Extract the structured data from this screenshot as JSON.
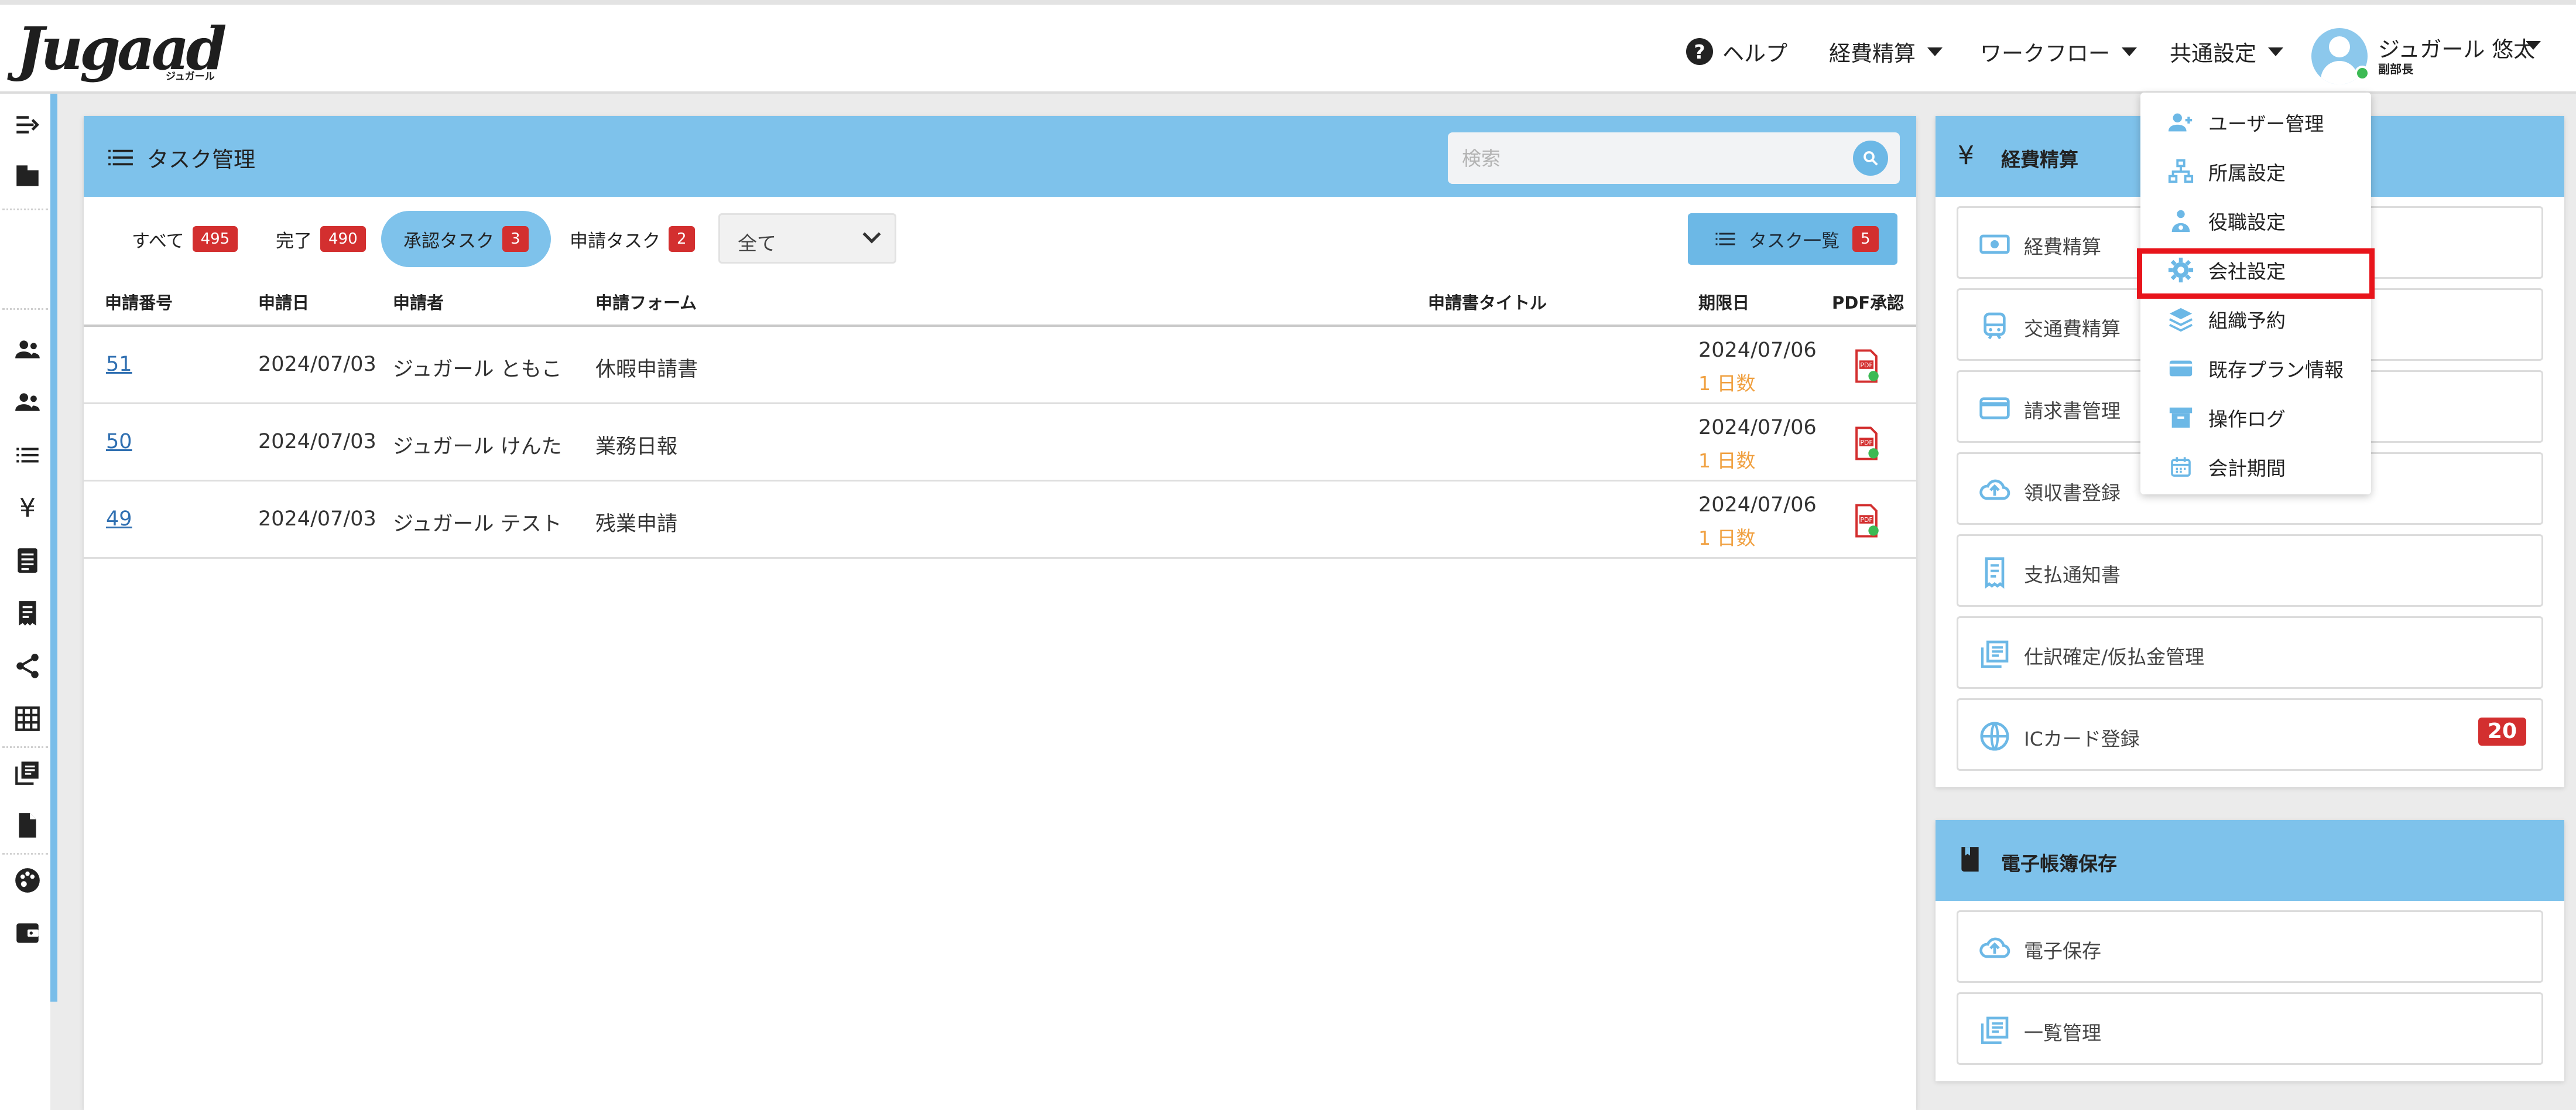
{
  "header": {
    "logo_text": "Jugaad",
    "logo_sub": "ジュガール",
    "nav": {
      "help": "ヘルプ",
      "expense": "経費精算",
      "workflow": "ワークフロー",
      "common": "共通設定"
    },
    "user": {
      "name": "ジュガール 悠太",
      "role": "副部長"
    }
  },
  "task_panel": {
    "title": "タスク管理",
    "search_placeholder": "検索",
    "filters": [
      {
        "label": "すべて",
        "count": "495"
      },
      {
        "label": "完了",
        "count": "490"
      },
      {
        "label": "承認タスク",
        "count": "3"
      },
      {
        "label": "申請タスク",
        "count": "2"
      }
    ],
    "select_value": "全て",
    "task_list_button": {
      "label": "タスク一覧",
      "count": "5"
    },
    "columns": [
      "申請番号",
      "申請日",
      "申請者",
      "申請フォーム",
      "申請書タイトル",
      "期限日",
      "PDF承認"
    ],
    "rows": [
      {
        "no": "51",
        "date": "2024/07/03",
        "applicant": "ジュガール ともこ",
        "form": "休暇申請書",
        "title": "",
        "due": "2024/07/06",
        "days": "1 日数"
      },
      {
        "no": "50",
        "date": "2024/07/03",
        "applicant": "ジュガール けんた",
        "form": "業務日報",
        "title": "",
        "due": "2024/07/06",
        "days": "1 日数"
      },
      {
        "no": "49",
        "date": "2024/07/03",
        "applicant": "ジュガール テスト",
        "form": "残業申請",
        "title": "",
        "due": "2024/07/06",
        "days": "1 日数"
      }
    ]
  },
  "expense_card": {
    "icon": "¥",
    "title": "経費精算",
    "items": [
      "経費精算",
      "交通費精算",
      "請求書管理",
      "領収書登録",
      "支払通知書",
      "仕訳確定/仮払金管理",
      "ICカード登録"
    ],
    "ic_badge": "20"
  },
  "ebook_card": {
    "title": "電子帳簿保存",
    "items": [
      "電子保存",
      "一覧管理"
    ]
  },
  "dropdown": {
    "items": [
      "ユーザー管理",
      "所属設定",
      "役職設定",
      "会社設定",
      "組織予約",
      "既存プラン情報",
      "操作ログ",
      "会計期間"
    ],
    "highlighted_index": 3
  },
  "colors": {
    "accent": "#7ec2eb",
    "badge": "#d32f2f",
    "highlight": "#e8141b",
    "due_days": "#f0a040",
    "link": "#2f6fb1"
  }
}
